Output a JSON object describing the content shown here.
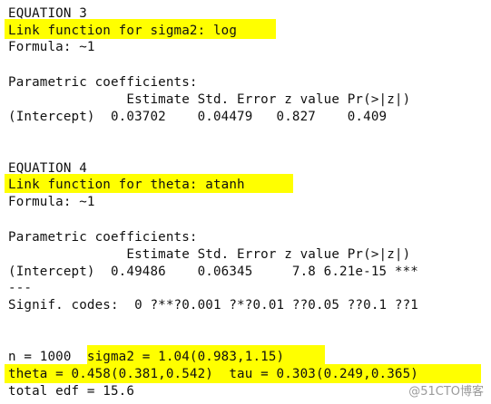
{
  "colors": {
    "background": "#ffffff",
    "text": "#101010",
    "highlight": "#ffff00",
    "watermark": "#9a9a9a"
  },
  "equation3": {
    "header": "EQUATION 3",
    "link": "Link function for sigma2: log",
    "formula": "Formula: ~1",
    "coef_title": "Parametric coefficients:",
    "coef_header": "               Estimate Std. Error z value Pr(>|z|)",
    "coef_row": "(Intercept)  0.03702    0.04479   0.827    0.409"
  },
  "equation4": {
    "header": "EQUATION 4",
    "link": "Link function for theta: atanh",
    "formula": "Formula: ~1",
    "coef_title": "Parametric coefficients:",
    "coef_header": "               Estimate Std. Error z value Pr(>|z|)",
    "coef_row": "(Intercept)  0.49486    0.06345     7.8 6.21e-15 ***",
    "separator": "---",
    "signif": "Signif. codes:  0 ?**?0.001 ?*?0.01 ??0.05 ??0.1 ??1"
  },
  "summary": {
    "n_line": "n = 1000  sigma2 = 1.04(0.983,1.15)",
    "theta_line": "theta = 0.458(0.381,0.542)  tau = 0.303(0.249,0.365)",
    "edf_line": "total edf = 15.6"
  },
  "watermark": "@51CTO博客"
}
